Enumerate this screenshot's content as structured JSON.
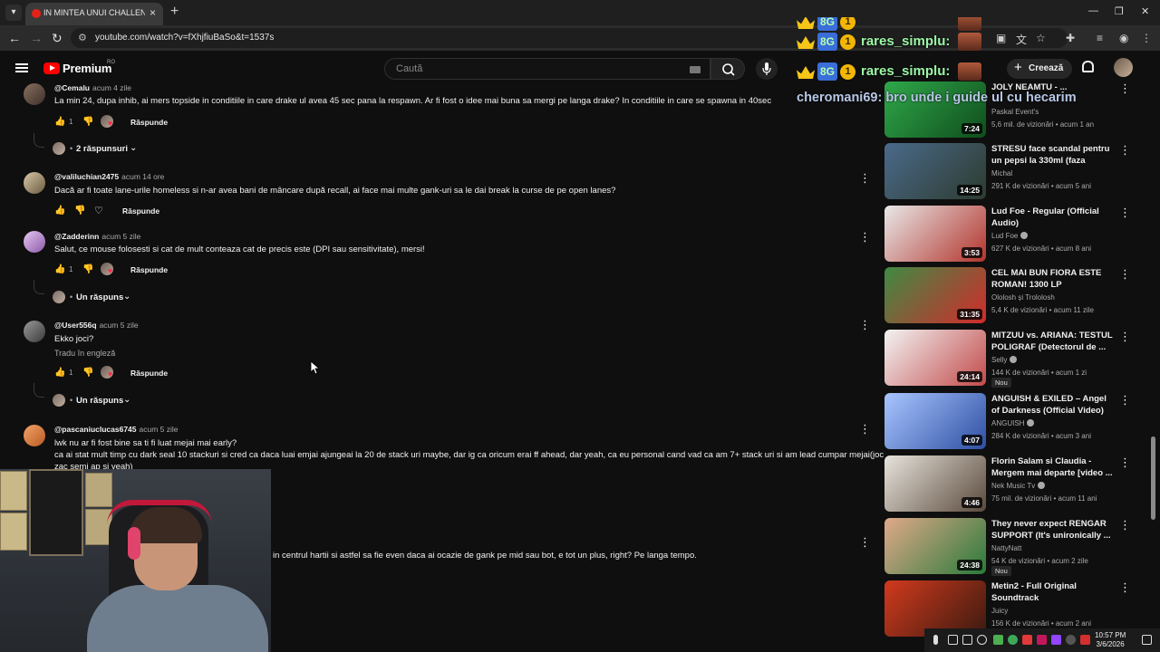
{
  "browser": {
    "tab_title": "IN MINTEA UNUI CHALLENGER",
    "url": "youtube.com/watch?v=fXhjfiuBaSo&t=1537s"
  },
  "masthead": {
    "brand": "Premium",
    "region": "RO",
    "search_placeholder": "Caută",
    "create_label": "Creează"
  },
  "comments": [
    {
      "user": "@Cemalu",
      "time": "acum 4 zile",
      "text": "La min 24, dupa inhib, ai mers topside in conditiile in care drake ul avea 45 sec pana la respawn. Ar fi fost o idee mai buna sa mergi pe langa drake?  In conditiile in care se spawna in 40sec",
      "likes": "1",
      "reply_label": "Răspunde",
      "replies_label": "2 răspunsuri"
    },
    {
      "user": "@valiluchian2475",
      "time": "acum 14 ore",
      "text": "Dacă ar fi toate lane-urile homeless si n-ar avea bani de mâncare după recall, ai face mai multe gank-uri sa le dai break la curse de pe open lanes?",
      "likes": "",
      "reply_label": "Răspunde"
    },
    {
      "user": "@Zadderinn",
      "time": "acum 5 zile",
      "text": "Salut, ce mouse folosesti si cat de mult conteaza cat de precis este (DPI sau sensitivitate), mersi!",
      "likes": "1",
      "reply_label": "Răspunde",
      "replies_label": "Un răspuns"
    },
    {
      "user": "@User556q",
      "time": "acum 5 zile",
      "text": "Ekko joci?",
      "translate": "Tradu în engleză",
      "likes": "1",
      "reply_label": "Răspunde",
      "replies_label": "Un răspuns"
    },
    {
      "user": "@pascaniuclucas6745",
      "time": "acum 5 zile",
      "text": "lwk nu ar fi fost bine sa ti fi luat mejai mai early?",
      "text2": "ca ai stat mult timp cu dark seal 10 stackuri si cred ca daca luai emjai ajungeai la 20 de stack uri maybe, dar ig ca oricum erai ff ahead, dar yeah, ca eu personal cand vad ca am 7+ stack uri si am lead cumpar mejai(joc",
      "text3": "zac semi ap si yeah)"
    },
    {
      "text": "in centrul hartii si astfel sa fie even daca ai ocazie de gank pe mid sau bot, e tot un plus, right? Pe langa tempo."
    }
  ],
  "live_chat": [
    {
      "name": "rares_simplu:",
      "badge": "8G",
      "level": "1"
    },
    {
      "name": "rares_simplu:",
      "badge": "8G",
      "level": "1"
    },
    {
      "message": "cheromani69: bro unde i guide ul cu hecarim"
    }
  ],
  "recommendations": [
    {
      "title": "JOLY NEAMTU - ...",
      "channel": "Paskal Event's",
      "meta": "5,6 mil. de vizionări • acum 1 an",
      "duration": "7:24",
      "verified": false,
      "color1": "#2fa84a",
      "color2": "#0f4d1c"
    },
    {
      "title": "STRESU face scandal pentru un pepsi la 330ml (faza integrala)",
      "channel": "Michal",
      "meta": "291 K de vizionări • acum 5 ani",
      "duration": "14:25",
      "verified": false,
      "color1": "#4a6a8a",
      "color2": "#2d3b2f"
    },
    {
      "title": "Lud Foe - Regular (Official Audio)",
      "channel": "Lud Foe",
      "meta": "627 K de vizionări • acum 8 ani",
      "duration": "3:53",
      "verified": true,
      "color1": "#e8e8e8",
      "color2": "#b3342c"
    },
    {
      "title": "CEL MAI BUN FIORA ESTE ROMAN! 1300 LP CHALLENGE...",
      "channel": "Ololosh și Trololosh",
      "meta": "5,4 K de vizionări • acum 11 zile",
      "duration": "31:35",
      "verified": false,
      "color1": "#3f8a44",
      "color2": "#d22b2b"
    },
    {
      "title": "MITZUU vs. ARIANA: TESTUL POLIGRAF (Detectorul de ...",
      "channel": "Selly",
      "meta": "144 K de vizionări • acum 1 zi",
      "duration": "24:14",
      "verified": true,
      "badge": "Nou",
      "color1": "#f3f3f3",
      "color2": "#c24a4a"
    },
    {
      "title": "ANGUISH & EXILED – Angel of Darkness (Official Video)",
      "channel": "ANGUISH",
      "meta": "284 K de vizionări • acum 3 ani",
      "duration": "4:07",
      "verified": true,
      "color1": "#a9c6ff",
      "color2": "#2e4fa3"
    },
    {
      "title": "Florin Salam si Claudia - Mergem mai departe [video ...",
      "channel": "Nek Music Tv",
      "meta": "75 mil. de vizionări • acum 11 ani",
      "duration": "4:46",
      "verified": true,
      "color1": "#e7e3dc",
      "color2": "#5b4a3c"
    },
    {
      "title": "They never expect RENGAR SUPPORT (It's unironically ...",
      "channel": "NattyNatt",
      "meta": "54 K de vizionări • acum 2 zile",
      "duration": "24:38",
      "verified": false,
      "badge": "Nou",
      "color1": "#e0a98a",
      "color2": "#2a7a3a"
    },
    {
      "title": "Metin2 - Full Original Soundtrack",
      "channel": "Juicy",
      "meta": "156 K de vizionări • acum 2 ani",
      "duration": "",
      "verified": false,
      "color1": "#d23a1d",
      "color2": "#3a1a10"
    }
  ],
  "tray": {
    "time": "10:57 PM",
    "date": "3/6/2026"
  },
  "colors": {
    "background": "#0f0f0f",
    "yt_red": "#ff0000",
    "chat_name": "#9cf7a6",
    "chat_message": "#b7c7e6"
  }
}
